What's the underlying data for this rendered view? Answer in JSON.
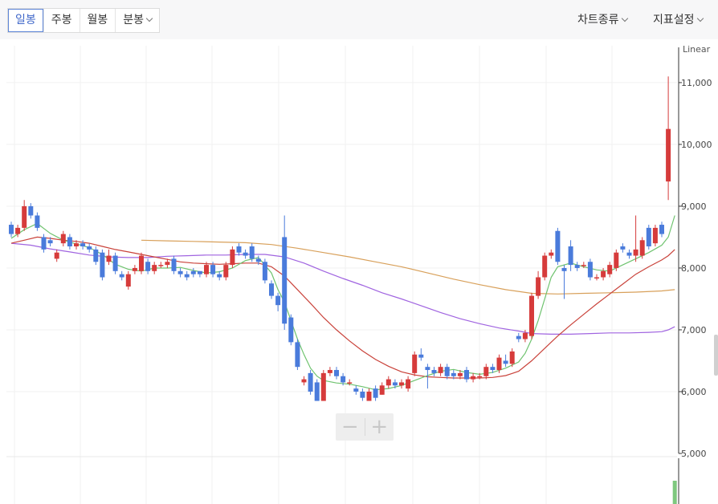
{
  "toolbar": {
    "tabs": [
      {
        "label": "일봉",
        "active": true
      },
      {
        "label": "주봉",
        "active": false
      },
      {
        "label": "월봉",
        "active": false
      },
      {
        "label": "분봉",
        "active": false
      }
    ],
    "chart_type_menu": "차트종류",
    "indicator_menu": "지표설정"
  },
  "scale_label": "Linear",
  "colors": {
    "up": "#d63b3b",
    "down": "#4a7bdb",
    "ma5": "#6fc36f",
    "ma20": "#c9423a",
    "ma60": "#a064e0",
    "ma120": "#d8a05a",
    "volume": "#7ec87e"
  },
  "chart_data": {
    "type": "candlestick",
    "title": "",
    "xlabel": "",
    "ylabel": "",
    "ylim": [
      5000,
      11700
    ],
    "yticks": [
      5000,
      6000,
      7000,
      8000,
      9000,
      10000,
      11000
    ],
    "ytick_labels": [
      "5,000",
      "6,000",
      "7,000",
      "8,000",
      "9,000",
      "10,000",
      "11,000"
    ],
    "candles": [
      [
        8700,
        8550,
        8750,
        8500
      ],
      [
        8550,
        8650,
        8700,
        8500
      ],
      [
        8650,
        9000,
        9100,
        8600
      ],
      [
        9000,
        8850,
        9050,
        8800
      ],
      [
        8850,
        8650,
        8900,
        8600
      ],
      [
        8500,
        8300,
        8550,
        8250
      ],
      [
        8450,
        8400,
        8500,
        8350
      ],
      [
        8150,
        8250,
        8300,
        8100
      ],
      [
        8400,
        8550,
        8600,
        8350
      ],
      [
        8500,
        8350,
        8550,
        8300
      ],
      [
        8350,
        8400,
        8450,
        8300
      ],
      [
        8400,
        8350,
        8450,
        8300
      ],
      [
        8350,
        8300,
        8400,
        8250
      ],
      [
        8300,
        8100,
        8350,
        8050
      ],
      [
        8250,
        7850,
        8300,
        7800
      ],
      [
        8100,
        8200,
        8300,
        8050
      ],
      [
        8200,
        7950,
        8250,
        7900
      ],
      [
        7900,
        7850,
        7950,
        7800
      ],
      [
        7700,
        7900,
        7950,
        7650
      ],
      [
        7950,
        8000,
        8050,
        7900
      ],
      [
        7950,
        8200,
        8250,
        7900
      ],
      [
        8100,
        7950,
        8150,
        7900
      ],
      [
        7950,
        8050,
        8100,
        7900
      ],
      [
        8050,
        8050,
        8100,
        8000
      ],
      [
        8050,
        8100,
        8150,
        8000
      ],
      [
        8150,
        7950,
        8200,
        7900
      ],
      [
        7950,
        7900,
        8000,
        7850
      ],
      [
        7900,
        7850,
        7950,
        7800
      ],
      [
        7950,
        7900,
        8000,
        7850
      ],
      [
        7950,
        7900,
        7950,
        7850
      ],
      [
        7900,
        8050,
        8100,
        7850
      ],
      [
        8050,
        7900,
        8100,
        7850
      ],
      [
        7900,
        7850,
        7950,
        7800
      ],
      [
        7850,
        8050,
        8100,
        7800
      ],
      [
        8050,
        8300,
        8350,
        8000
      ],
      [
        8350,
        8250,
        8400,
        8200
      ],
      [
        8250,
        8200,
        8300,
        8150
      ],
      [
        8350,
        8150,
        8400,
        8100
      ],
      [
        8150,
        8100,
        8200,
        8050
      ],
      [
        8100,
        7800,
        8150,
        7750
      ],
      [
        7750,
        7550,
        7800,
        7500
      ],
      [
        7550,
        7400,
        7600,
        7300
      ],
      [
        8500,
        7100,
        8850,
        7000
      ],
      [
        7200,
        6800,
        7250,
        6750
      ],
      [
        6800,
        6400,
        6850,
        6350
      ],
      [
        6150,
        6200,
        6250,
        6100
      ],
      [
        6300,
        6000,
        6350,
        5950
      ],
      [
        6150,
        5850,
        6200,
        5850
      ],
      [
        5850,
        6300,
        6350,
        5850
      ],
      [
        6300,
        6350,
        6400,
        6250
      ],
      [
        6350,
        6250,
        6400,
        6200
      ],
      [
        6250,
        6150,
        6300,
        6100
      ],
      [
        6150,
        6150,
        6200,
        6100
      ],
      [
        6050,
        6000,
        6100,
        5950
      ],
      [
        6000,
        5900,
        6050,
        5850
      ],
      [
        5850,
        6000,
        6050,
        5850
      ],
      [
        6050,
        5900,
        6100,
        5850
      ],
      [
        5950,
        6100,
        6150,
        5950
      ],
      [
        6100,
        6200,
        6250,
        6050
      ],
      [
        6150,
        6100,
        6200,
        6050
      ],
      [
        6100,
        6150,
        6200,
        6050
      ],
      [
        6050,
        6200,
        6250,
        6000
      ],
      [
        6300,
        6600,
        6650,
        6250
      ],
      [
        6600,
        6550,
        6700,
        6500
      ],
      [
        6400,
        6350,
        6450,
        6050
      ],
      [
        6350,
        6300,
        6400,
        6250
      ],
      [
        6300,
        6400,
        6450,
        6250
      ],
      [
        6400,
        6250,
        6450,
        6200
      ],
      [
        6300,
        6250,
        6350,
        6200
      ],
      [
        6250,
        6300,
        6350,
        6200
      ],
      [
        6350,
        6200,
        6400,
        6150
      ],
      [
        6200,
        6250,
        6300,
        6150
      ],
      [
        6250,
        6250,
        6300,
        6200
      ],
      [
        6250,
        6400,
        6450,
        6200
      ],
      [
        6400,
        6350,
        6450,
        6300
      ],
      [
        6350,
        6550,
        6600,
        6300
      ],
      [
        6500,
        6450,
        6600,
        6400
      ],
      [
        6450,
        6650,
        6700,
        6400
      ],
      [
        6900,
        6850,
        6950,
        6800
      ],
      [
        6850,
        6950,
        7000,
        6800
      ],
      [
        6900,
        7550,
        7600,
        6850
      ],
      [
        7550,
        7850,
        7950,
        7500
      ],
      [
        7850,
        8200,
        8250,
        7800
      ],
      [
        8200,
        8250,
        8300,
        8150
      ],
      [
        8600,
        8100,
        8650,
        8050
      ],
      [
        8000,
        7950,
        8050,
        7500
      ],
      [
        8350,
        8050,
        8450,
        7950
      ],
      [
        8050,
        8000,
        8100,
        7950
      ],
      [
        8050,
        8050,
        8100,
        8000
      ],
      [
        8100,
        7850,
        8150,
        7800
      ],
      [
        7850,
        7850,
        7900,
        7800
      ],
      [
        7850,
        7950,
        8000,
        7800
      ],
      [
        7900,
        8050,
        8100,
        7850
      ],
      [
        8000,
        8250,
        8300,
        7950
      ],
      [
        8350,
        8300,
        8400,
        8250
      ],
      [
        8250,
        8200,
        8300,
        8150
      ],
      [
        8200,
        8300,
        8850,
        8100
      ],
      [
        8200,
        8450,
        8500,
        8150
      ],
      [
        8650,
        8350,
        8700,
        8300
      ],
      [
        8400,
        8650,
        8700,
        8350
      ],
      [
        8700,
        8550,
        8750,
        8500
      ],
      [
        9400,
        10250,
        11100,
        9100
      ]
    ],
    "ma5": [
      [
        0,
        8480
      ],
      [
        2,
        8620
      ],
      [
        4,
        8720
      ],
      [
        6,
        8560
      ],
      [
        8,
        8450
      ],
      [
        10,
        8390
      ],
      [
        12,
        8330
      ],
      [
        14,
        8220
      ],
      [
        16,
        8060
      ],
      [
        18,
        7980
      ],
      [
        20,
        7950
      ],
      [
        22,
        8000
      ],
      [
        24,
        8000
      ],
      [
        26,
        8010
      ],
      [
        28,
        7960
      ],
      [
        30,
        7920
      ],
      [
        32,
        7940
      ],
      [
        34,
        8000
      ],
      [
        36,
        8120
      ],
      [
        38,
        8170
      ],
      [
        40,
        7920
      ],
      [
        41,
        7650
      ],
      [
        42,
        7450
      ],
      [
        43,
        7150
      ],
      [
        44,
        6850
      ],
      [
        45,
        6600
      ],
      [
        46,
        6380
      ],
      [
        47,
        6250
      ],
      [
        48,
        6180
      ],
      [
        50,
        6140
      ],
      [
        52,
        6120
      ],
      [
        54,
        6080
      ],
      [
        56,
        6030
      ],
      [
        58,
        6050
      ],
      [
        60,
        6100
      ],
      [
        62,
        6180
      ],
      [
        64,
        6260
      ],
      [
        66,
        6330
      ],
      [
        68,
        6360
      ],
      [
        70,
        6310
      ],
      [
        72,
        6280
      ],
      [
        74,
        6310
      ],
      [
        76,
        6380
      ],
      [
        78,
        6480
      ],
      [
        79,
        6620
      ],
      [
        80,
        6850
      ],
      [
        81,
        7150
      ],
      [
        82,
        7500
      ],
      [
        83,
        7850
      ],
      [
        84,
        8020
      ],
      [
        86,
        8080
      ],
      [
        88,
        8020
      ],
      [
        90,
        7970
      ],
      [
        92,
        7950
      ],
      [
        94,
        8050
      ],
      [
        96,
        8150
      ],
      [
        98,
        8250
      ],
      [
        100,
        8370
      ],
      [
        101,
        8500
      ],
      [
        102,
        8850
      ]
    ],
    "ma20": [
      [
        0,
        8400
      ],
      [
        2,
        8450
      ],
      [
        4,
        8500
      ],
      [
        6,
        8480
      ],
      [
        8,
        8450
      ],
      [
        10,
        8430
      ],
      [
        12,
        8400
      ],
      [
        14,
        8350
      ],
      [
        16,
        8300
      ],
      [
        18,
        8260
      ],
      [
        20,
        8220
      ],
      [
        22,
        8180
      ],
      [
        24,
        8140
      ],
      [
        26,
        8100
      ],
      [
        28,
        8080
      ],
      [
        30,
        8070
      ],
      [
        32,
        8060
      ],
      [
        34,
        8070
      ],
      [
        36,
        8080
      ],
      [
        38,
        8080
      ],
      [
        40,
        8020
      ],
      [
        42,
        7870
      ],
      [
        44,
        7650
      ],
      [
        46,
        7430
      ],
      [
        48,
        7200
      ],
      [
        50,
        7000
      ],
      [
        52,
        6820
      ],
      [
        54,
        6660
      ],
      [
        56,
        6520
      ],
      [
        58,
        6410
      ],
      [
        60,
        6320
      ],
      [
        62,
        6270
      ],
      [
        64,
        6240
      ],
      [
        66,
        6230
      ],
      [
        68,
        6220
      ],
      [
        70,
        6220
      ],
      [
        72,
        6220
      ],
      [
        74,
        6230
      ],
      [
        76,
        6260
      ],
      [
        78,
        6330
      ],
      [
        80,
        6500
      ],
      [
        82,
        6700
      ],
      [
        84,
        6900
      ],
      [
        86,
        7080
      ],
      [
        88,
        7250
      ],
      [
        90,
        7420
      ],
      [
        92,
        7580
      ],
      [
        94,
        7740
      ],
      [
        96,
        7900
      ],
      [
        98,
        8020
      ],
      [
        100,
        8130
      ],
      [
        101,
        8200
      ],
      [
        102,
        8300
      ]
    ],
    "ma60": [
      [
        0,
        8400
      ],
      [
        3,
        8370
      ],
      [
        6,
        8310
      ],
      [
        9,
        8260
      ],
      [
        12,
        8210
      ],
      [
        15,
        8180
      ],
      [
        18,
        8170
      ],
      [
        21,
        8170
      ],
      [
        24,
        8190
      ],
      [
        27,
        8200
      ],
      [
        30,
        8210
      ],
      [
        33,
        8210
      ],
      [
        36,
        8220
      ],
      [
        39,
        8220
      ],
      [
        42,
        8180
      ],
      [
        45,
        8080
      ],
      [
        48,
        7950
      ],
      [
        51,
        7830
      ],
      [
        54,
        7720
      ],
      [
        57,
        7600
      ],
      [
        60,
        7500
      ],
      [
        63,
        7390
      ],
      [
        66,
        7280
      ],
      [
        69,
        7180
      ],
      [
        72,
        7100
      ],
      [
        75,
        7030
      ],
      [
        78,
        6980
      ],
      [
        80,
        6940
      ],
      [
        83,
        6930
      ],
      [
        86,
        6930
      ],
      [
        89,
        6940
      ],
      [
        92,
        6950
      ],
      [
        95,
        6950
      ],
      [
        98,
        6960
      ],
      [
        100,
        6970
      ],
      [
        101,
        7000
      ],
      [
        102,
        7050
      ]
    ],
    "ma120": [
      [
        20,
        8450
      ],
      [
        24,
        8440
      ],
      [
        28,
        8430
      ],
      [
        32,
        8420
      ],
      [
        36,
        8410
      ],
      [
        40,
        8380
      ],
      [
        44,
        8320
      ],
      [
        48,
        8250
      ],
      [
        52,
        8180
      ],
      [
        56,
        8100
      ],
      [
        60,
        8020
      ],
      [
        64,
        7920
      ],
      [
        68,
        7820
      ],
      [
        72,
        7730
      ],
      [
        76,
        7650
      ],
      [
        80,
        7590
      ],
      [
        84,
        7580
      ],
      [
        88,
        7590
      ],
      [
        92,
        7600
      ],
      [
        96,
        7610
      ],
      [
        100,
        7630
      ],
      [
        102,
        7650
      ]
    ],
    "volume": [
      {
        "index": 102,
        "ratio": 1.0
      }
    ]
  }
}
